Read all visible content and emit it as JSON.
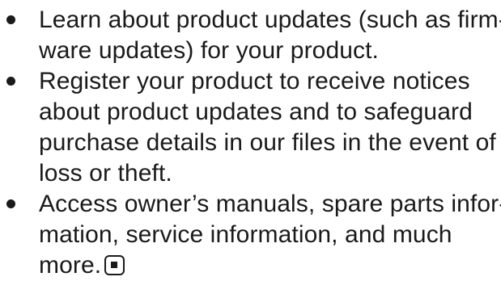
{
  "bullets": [
    {
      "lines": [
        "Learn about product updates (such as firm-",
        "ware updates) for your product."
      ]
    },
    {
      "lines": [
        "Register your product to receive notices",
        "about product updates and to safeguard",
        "purchase details in our files in the event of",
        "loss or theft."
      ]
    },
    {
      "lines": [
        "Access owner’s manuals, spare parts infor-",
        "mation, service information, and much",
        "more."
      ]
    }
  ],
  "end_mark_icon": "end-of-section-square-icon"
}
